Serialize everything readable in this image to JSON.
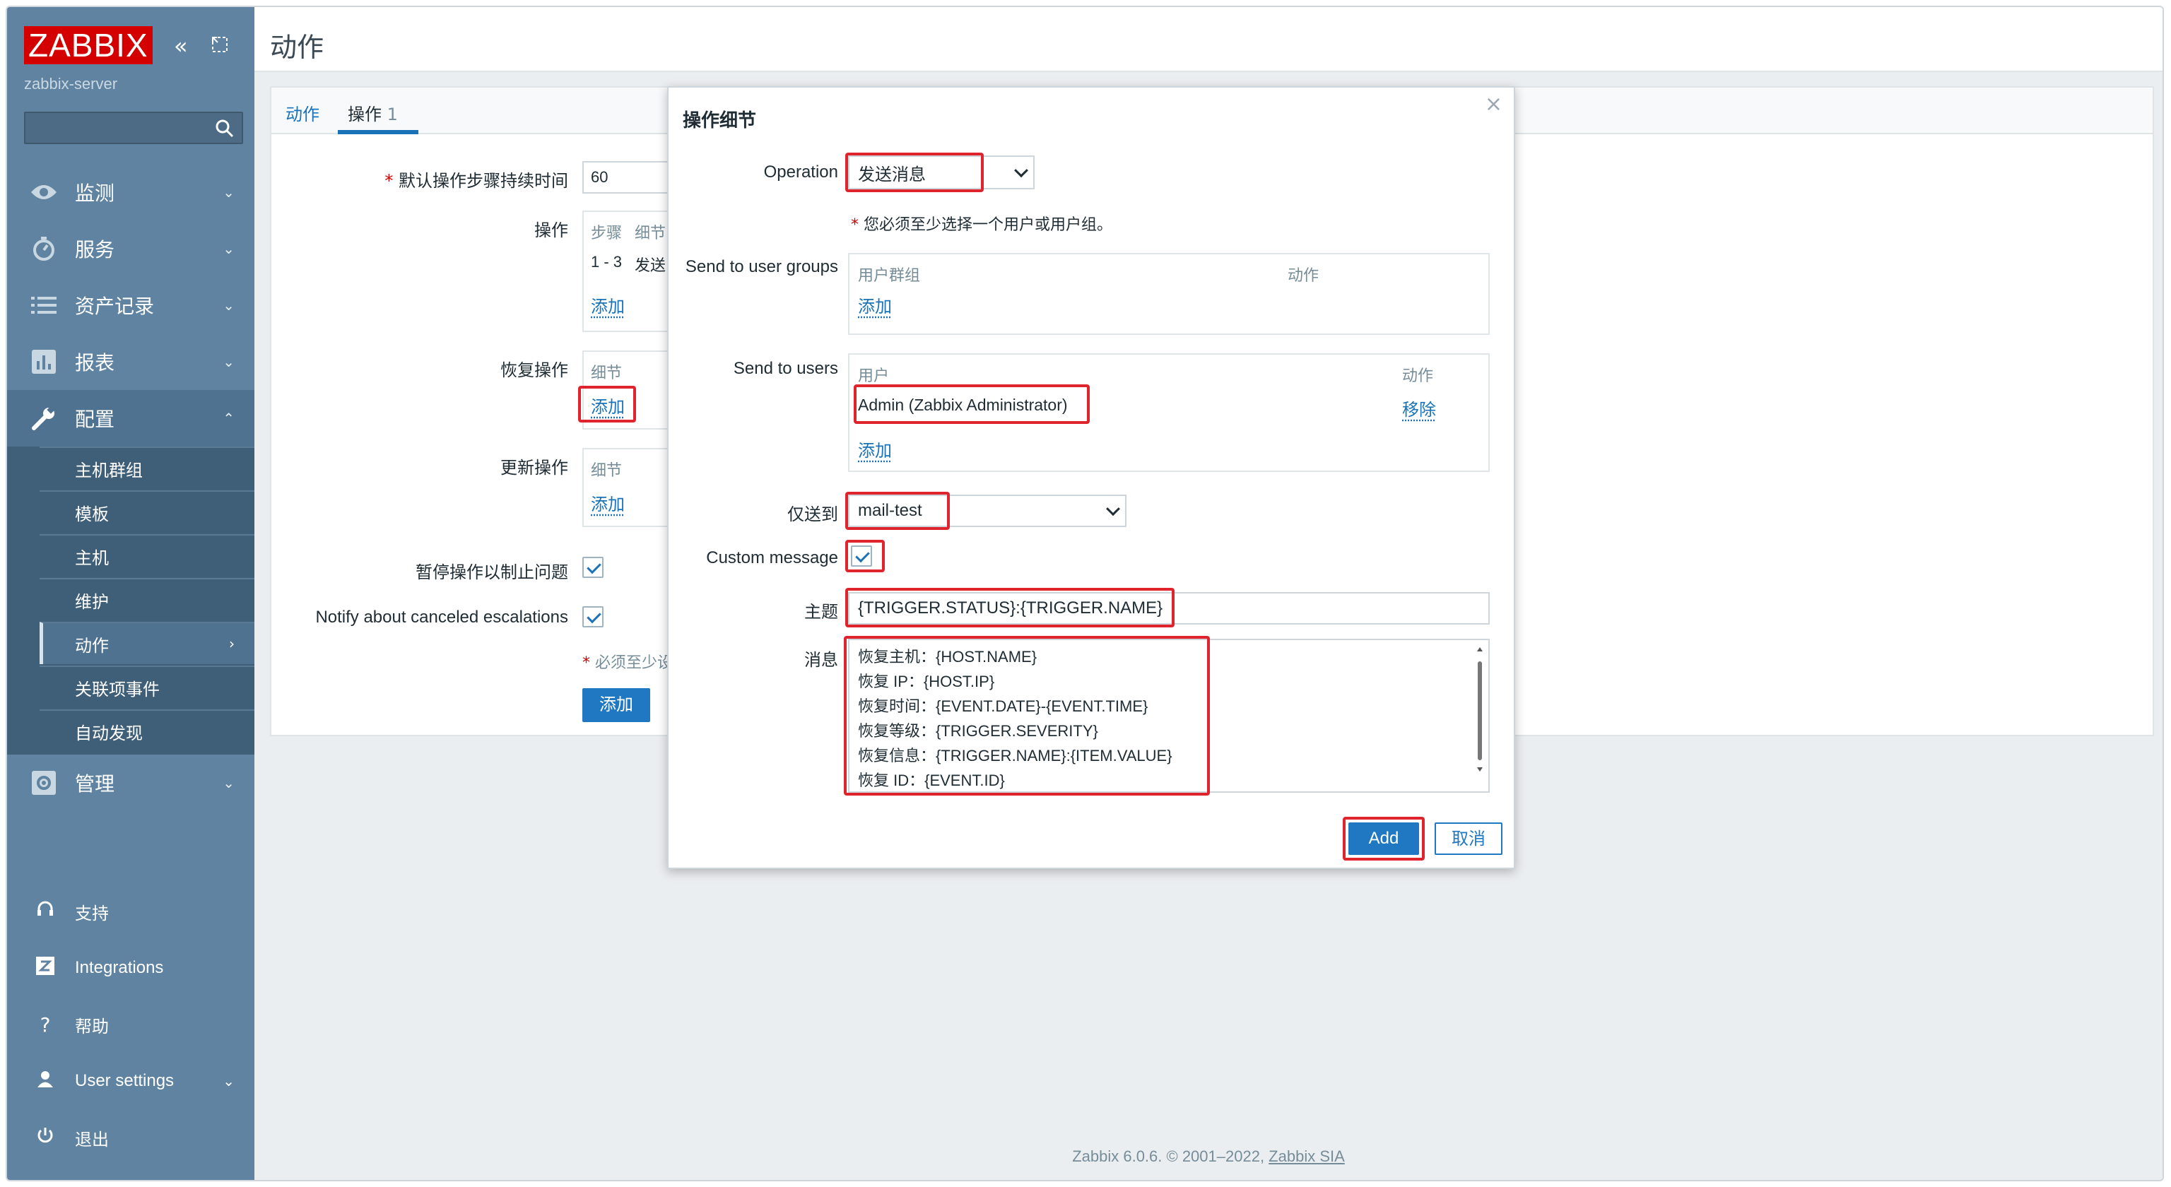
{
  "app": {
    "logo": "ZABBIX",
    "server": "zabbix-server",
    "page_title": "动作",
    "footer_text": "Zabbix 6.0.6. © 2001–2022, ",
    "footer_link": "Zabbix SIA"
  },
  "sidebar": {
    "search_placeholder": "",
    "main": [
      {
        "label": "监测",
        "icon": "eye-icon"
      },
      {
        "label": "服务",
        "icon": "clock-icon"
      },
      {
        "label": "资产记录",
        "icon": "list-icon"
      },
      {
        "label": "报表",
        "icon": "chart-icon"
      },
      {
        "label": "配置",
        "icon": "wrench-icon"
      },
      {
        "label": "管理",
        "icon": "gear-icon"
      }
    ],
    "config_sub": [
      "主机群组",
      "模板",
      "主机",
      "维护",
      "动作",
      "关联项事件",
      "自动发现"
    ],
    "bottom": [
      {
        "label": "支持",
        "icon": "headset-icon"
      },
      {
        "label": "Integrations",
        "icon": "z-icon"
      },
      {
        "label": "帮助",
        "icon": "question-icon"
      },
      {
        "label": "User settings",
        "icon": "user-icon"
      },
      {
        "label": "退出",
        "icon": "power-icon"
      }
    ]
  },
  "tabs": {
    "action": "动作",
    "operations": "操作",
    "operations_count": "1"
  },
  "form": {
    "default_duration_label": "默认操作步骤持续时间",
    "default_duration_value": "60",
    "operations_label": "操作",
    "col_steps": "步骤",
    "col_details": "细节",
    "op_row_steps": "1 - 3",
    "op_row_detail": "发送",
    "add": "添加",
    "recovery_label": "恢复操作",
    "update_label": "更新操作",
    "details_header": "细节",
    "pause_label": "暂停操作以制止问题",
    "notify_label": "Notify about canceled escalations",
    "required_note": "必须至少设",
    "add_button": "添加"
  },
  "modal": {
    "title": "操作细节",
    "operation_label": "Operation",
    "operation_value": "发送消息",
    "required_hint": "您必须至少选择一个用户或用户组。",
    "groups_label": "Send to user groups",
    "groups_col_group": "用户群组",
    "groups_col_action": "动作",
    "groups_add": "添加",
    "users_label": "Send to users",
    "users_col_user": "用户",
    "users_col_action": "动作",
    "user_name": "Admin (Zabbix Administrator)",
    "user_remove": "移除",
    "users_add": "添加",
    "send_only_label": "仅送到",
    "send_only_value": "mail-test",
    "custom_message_label": "Custom message",
    "subject_label": "主题",
    "subject_value": "{TRIGGER.STATUS}:{TRIGGER.NAME}",
    "message_label": "消息",
    "message_lines": [
      "恢复主机：{HOST.NAME}",
      "恢复  IP：{HOST.IP}",
      "恢复时间：{EVENT.DATE}-{EVENT.TIME}",
      "恢复等级：{TRIGGER.SEVERITY}",
      "恢复信息：{TRIGGER.NAME}:{ITEM.VALUE}",
      "恢复  ID：{EVENT.ID}"
    ],
    "add_button": "Add",
    "cancel_button": "取消"
  },
  "colors": {
    "brand_red": "#d40000",
    "sidebar": "#5f83a0",
    "accent_blue": "#1f78c1",
    "highlight_red": "#e0242e"
  }
}
